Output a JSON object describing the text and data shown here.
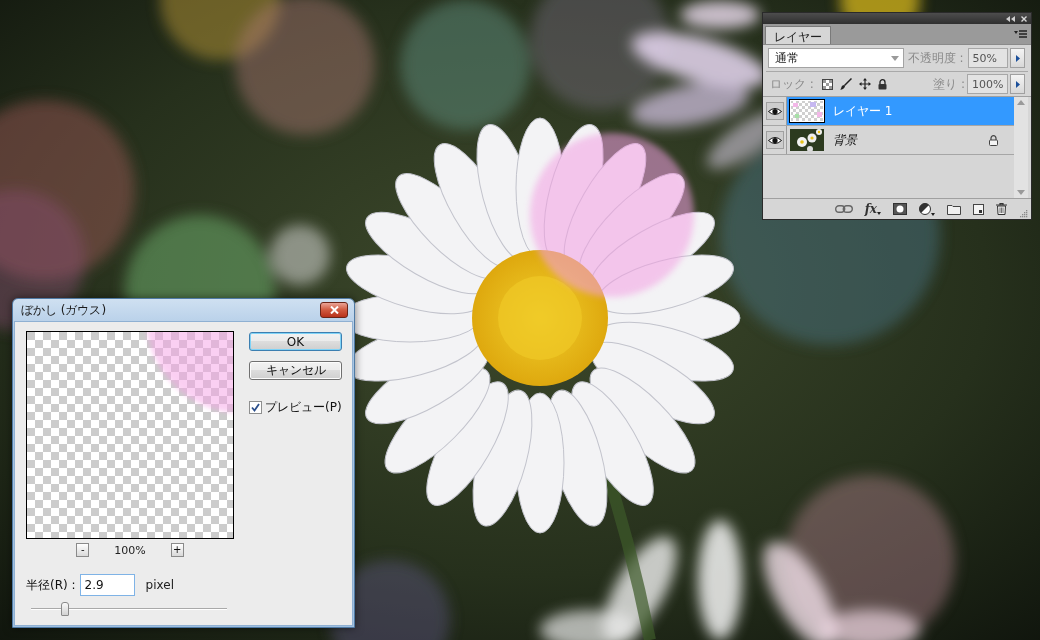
{
  "layers_panel": {
    "tab": {
      "label": "レイヤー",
      "selected": true
    },
    "blend_mode": "通常",
    "opacity": {
      "label": "不透明度 :",
      "value": "50%"
    },
    "lock_label": "ロック :",
    "fill": {
      "label": "塗り :",
      "value": "100%"
    },
    "layers": [
      {
        "name": "レイヤー 1",
        "kind": "pixel",
        "selected": true,
        "visible": true,
        "locked": false
      },
      {
        "name": "背景",
        "kind": "background",
        "selected": false,
        "visible": true,
        "locked": true
      }
    ],
    "effects_button": "fx"
  },
  "dialog": {
    "title": "ぼかし (ガウス)",
    "buttons": [
      {
        "label": "OK",
        "default": true
      },
      {
        "label": "キャンセル",
        "default": false
      }
    ],
    "preview": {
      "label": "プレビュー(P)",
      "checked": true
    },
    "zoom": {
      "minus": "-",
      "value": "100%",
      "plus": "+"
    },
    "radius": {
      "label": "半径(R) :",
      "value": "2.9",
      "unit": "pixel"
    },
    "slider": {
      "level": 0.16
    }
  }
}
